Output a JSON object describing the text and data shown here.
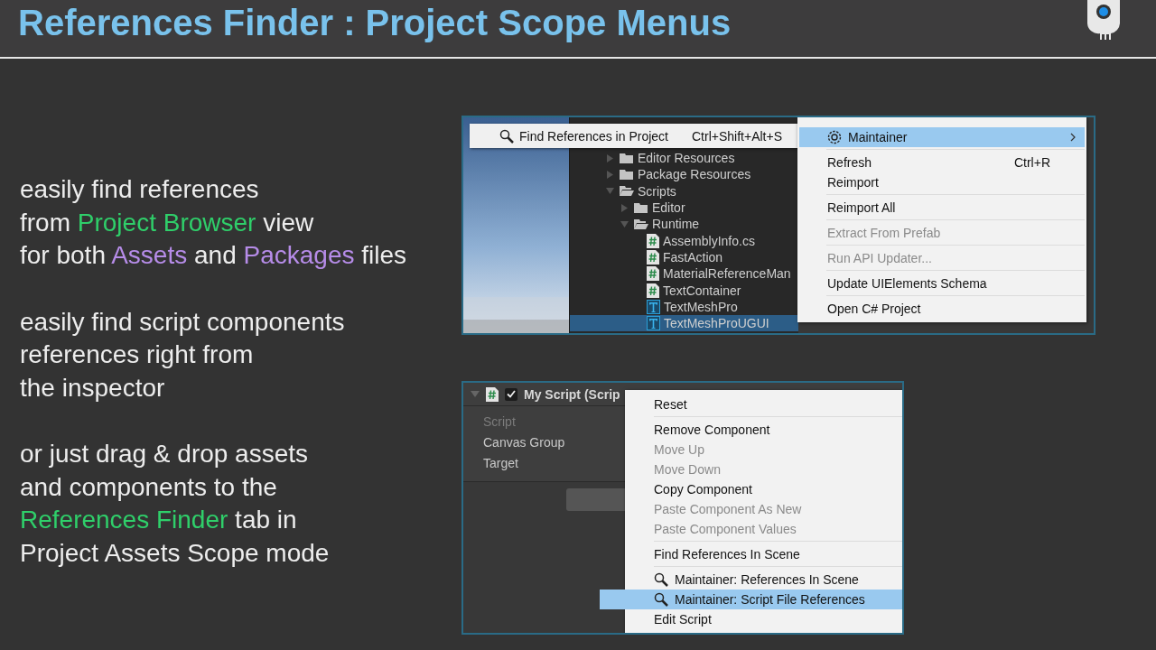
{
  "header": {
    "title": "References Finder : Project Scope Menus"
  },
  "description": [
    {
      "lines": [
        [
          {
            "text": "easily find references"
          }
        ],
        [
          {
            "text": "from "
          },
          {
            "text": "Project Browser",
            "color": "#2fcf6a"
          },
          {
            "text": " view"
          }
        ],
        [
          {
            "text": "for both "
          },
          {
            "text": "Assets",
            "color": "#b68ce8"
          },
          {
            "text": " and "
          },
          {
            "text": "Packages",
            "color": "#b68ce8"
          },
          {
            "text": " files"
          }
        ]
      ]
    },
    {
      "lines": [
        [
          {
            "text": "easily find script components"
          }
        ],
        [
          {
            "text": "references right from"
          }
        ],
        [
          {
            "text": "the inspector"
          }
        ]
      ]
    },
    {
      "lines": [
        [
          {
            "text": "or just drag & drop assets"
          }
        ],
        [
          {
            "text": "and components to the"
          }
        ],
        [
          {
            "text": "References Finder",
            "color": "#2fcf6a"
          },
          {
            "text": " tab in"
          }
        ],
        [
          {
            "text": "Project Assets Scope mode"
          }
        ]
      ]
    }
  ],
  "project_browser": {
    "tree": [
      {
        "kind": "folder",
        "label": "Editor Resources",
        "expanded": false,
        "selected": false
      },
      {
        "kind": "folder",
        "label": "Package Resources",
        "expanded": false,
        "selected": false
      },
      {
        "kind": "folder",
        "label": "Scripts",
        "expanded": true,
        "selected": false,
        "children": [
          {
            "kind": "folder",
            "label": "Editor",
            "expanded": false,
            "selected": false
          },
          {
            "kind": "folder",
            "label": "Runtime",
            "expanded": true,
            "selected": false,
            "children": [
              {
                "kind": "script",
                "label": "AssemblyInfo.cs",
                "selected": false
              },
              {
                "kind": "script",
                "label": "FastAction",
                "selected": false
              },
              {
                "kind": "script",
                "label": "MaterialReferenceMan",
                "selected": false
              },
              {
                "kind": "script",
                "label": "TextContainer",
                "selected": false
              },
              {
                "kind": "text-asset",
                "label": "TextMeshPro",
                "selected": false
              },
              {
                "kind": "text-asset",
                "label": "TextMeshProUGUI",
                "selected": true
              }
            ]
          }
        ]
      }
    ],
    "popup": {
      "label": "Find References in Project",
      "shortcut": "Ctrl+Shift+Alt+S"
    },
    "context_menu": [
      {
        "kind": "submenu",
        "label": "Maintainer",
        "selected": true,
        "disabled": false,
        "divider_before": false
      },
      {
        "label": "Refresh",
        "shortcut": "Ctrl+R",
        "selected": false,
        "disabled": false,
        "divider_before": true
      },
      {
        "label": "Reimport",
        "selected": false,
        "disabled": false,
        "divider_before": false
      },
      {
        "label": "Reimport All",
        "selected": false,
        "disabled": false,
        "divider_before": true
      },
      {
        "label": "Extract From Prefab",
        "selected": false,
        "disabled": true,
        "divider_before": true
      },
      {
        "label": "Run API Updater...",
        "selected": false,
        "disabled": true,
        "divider_before": true
      },
      {
        "label": "Update UIElements Schema",
        "selected": false,
        "disabled": false,
        "divider_before": true
      },
      {
        "label": "Open C# Project",
        "selected": false,
        "disabled": false,
        "divider_before": true
      }
    ]
  },
  "inspector": {
    "component": {
      "title": "My Script (Scrip",
      "expanded": true,
      "enabled": true
    },
    "fields": [
      {
        "label": "Script",
        "disabled": true
      },
      {
        "label": "Canvas Group",
        "disabled": false
      },
      {
        "label": "Target",
        "disabled": false
      }
    ],
    "context_menu": [
      {
        "label": "Reset",
        "selected": false,
        "disabled": false,
        "divider_before": false
      },
      {
        "label": "Remove Component",
        "selected": false,
        "disabled": false,
        "divider_before": true
      },
      {
        "label": "Move Up",
        "selected": false,
        "disabled": true,
        "divider_before": false
      },
      {
        "label": "Move Down",
        "selected": false,
        "disabled": true,
        "divider_before": false
      },
      {
        "label": "Copy Component",
        "selected": false,
        "disabled": false,
        "divider_before": false
      },
      {
        "label": "Paste Component As New",
        "selected": false,
        "disabled": true,
        "divider_before": false
      },
      {
        "label": "Paste Component Values",
        "selected": false,
        "disabled": true,
        "divider_before": false
      },
      {
        "label": "Find References In Scene",
        "selected": false,
        "disabled": false,
        "divider_before": true
      },
      {
        "kind": "finder",
        "label": "Maintainer: References In Scene",
        "selected": false,
        "disabled": false,
        "divider_before": true
      },
      {
        "kind": "finder",
        "label": "Maintainer: Script File References",
        "selected": true,
        "disabled": false,
        "divider_before": false
      },
      {
        "label": "Edit Script",
        "selected": false,
        "disabled": false,
        "divider_before": false
      }
    ]
  }
}
